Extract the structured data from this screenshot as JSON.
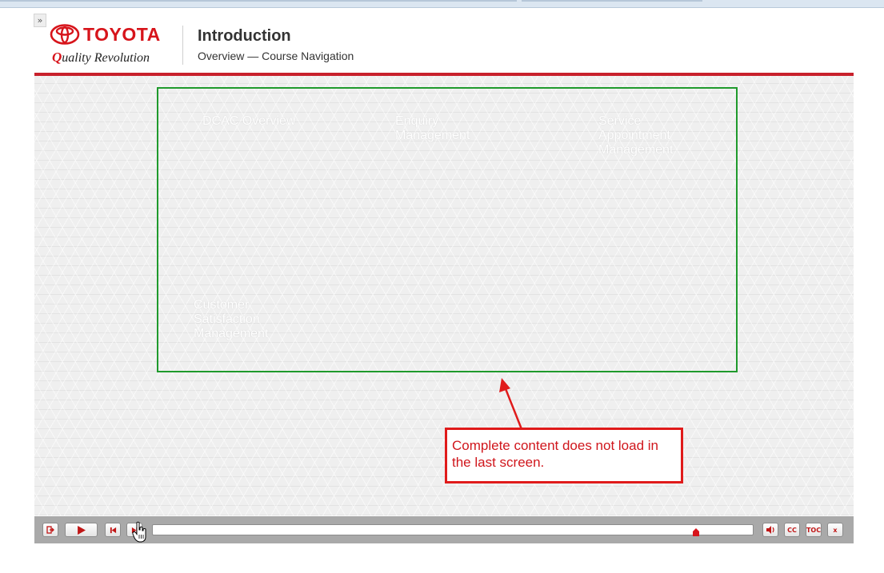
{
  "header": {
    "expand_label": "»",
    "logo_brand": "TOYOTA",
    "logo_tagline_first": "Q",
    "logo_tagline_rest": "uality Revolution",
    "title": "Introduction",
    "subtitle": "Overview — Course Navigation"
  },
  "topics": [
    {
      "label": "DCAC Overview"
    },
    {
      "label": "Enquiry Management"
    },
    {
      "label": "Service Appointment Management"
    },
    {
      "label": "Customer Satisfaction Management"
    }
  ],
  "callout": {
    "text": "Complete content does not load in the last screen."
  },
  "player": {
    "progress_fraction": 0.905,
    "buttons": {
      "exit": "exit-icon",
      "play": "play-icon",
      "previous": "skip-back-icon",
      "next": "skip-forward-icon",
      "audio": "volume-icon",
      "cc_label": "CC",
      "toc_label": "TOC",
      "close_label": "x"
    }
  },
  "colors": {
    "brand_red": "#d7141b",
    "header_rule": "#c8202b",
    "content_border": "#1f9a2c",
    "callout_red": "#e01b1b",
    "player_bar": "#a9a9a9"
  }
}
